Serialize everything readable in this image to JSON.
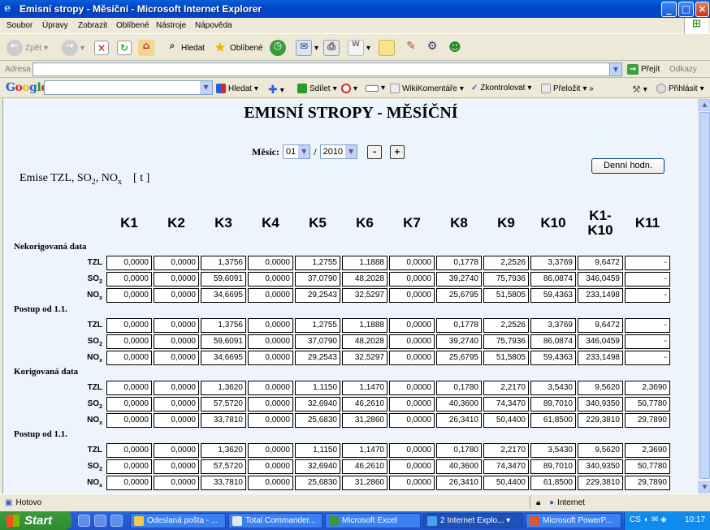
{
  "window": {
    "title": "Emisní stropy - Měsíční - Microsoft Internet Explorer"
  },
  "menu": [
    "Soubor",
    "Úpravy",
    "Zobrazit",
    "Oblíbené",
    "Nástroje",
    "Nápověda"
  ],
  "toolbar": {
    "back": "Zpět",
    "search": "Hledat",
    "favorites": "Oblíbené"
  },
  "address": {
    "label": "Adresa",
    "value": "",
    "go": "Přejít",
    "links": "Odkazy"
  },
  "google": {
    "logo": "Google",
    "search_value": "",
    "search": "Hledat",
    "share": "Sdílet",
    "wiki": "WikiKomentáře",
    "check": "Zkontrolovat",
    "translate": "Přeložit",
    "login": "Přihlásit"
  },
  "page": {
    "title": "EMISNÍ STROPY - MĚSÍČNÍ",
    "month_label": "Měsíc:",
    "month_value": "01",
    "separator": "/",
    "year_value": "2010",
    "minus": "-",
    "plus": "+",
    "daily_button": "Denní hodn.",
    "emise_text": "Emise TZL, SO",
    "emise_sub1": "2",
    "emise_mid": ", NO",
    "emise_sub2": "x",
    "unit": "[ t ]",
    "columns": [
      "K1",
      "K2",
      "K3",
      "K4",
      "K5",
      "K6",
      "K7",
      "K8",
      "K9",
      "K10",
      "K1-\nK10",
      "K11"
    ],
    "groups": [
      {
        "label": "Nekorigovaná data",
        "rows": [
          {
            "name": "TZL",
            "sub": "",
            "values": [
              "0,0000",
              "0,0000",
              "1,3756",
              "0,0000",
              "1,2755",
              "1,1888",
              "0,0000",
              "0,1778",
              "2,2526",
              "3,3769",
              "9,6472",
              "-"
            ]
          },
          {
            "name": "SO",
            "sub": "2",
            "values": [
              "0,0000",
              "0,0000",
              "59,6091",
              "0,0000",
              "37,0790",
              "48,2028",
              "0,0000",
              "39,2740",
              "75,7936",
              "86,0874",
              "346,0459",
              "-"
            ]
          },
          {
            "name": "NO",
            "sub": "x",
            "values": [
              "0,0000",
              "0,0000",
              "34,6695",
              "0,0000",
              "29,2543",
              "32,5297",
              "0,0000",
              "25,6795",
              "51,5805",
              "59,4363",
              "233,1498",
              "-"
            ]
          }
        ]
      },
      {
        "label": "Postup od 1.1.",
        "rows": [
          {
            "name": "TZL",
            "sub": "",
            "values": [
              "0,0000",
              "0,0000",
              "1,3756",
              "0,0000",
              "1,2755",
              "1,1888",
              "0,0000",
              "0,1778",
              "2,2526",
              "3,3769",
              "9,6472",
              "-"
            ]
          },
          {
            "name": "SO",
            "sub": "2",
            "values": [
              "0,0000",
              "0,0000",
              "59,6091",
              "0,0000",
              "37,0790",
              "48,2028",
              "0,0000",
              "39,2740",
              "75,7936",
              "86,0874",
              "346,0459",
              "-"
            ]
          },
          {
            "name": "NO",
            "sub": "x",
            "values": [
              "0,0000",
              "0,0000",
              "34,6695",
              "0,0000",
              "29,2543",
              "32,5297",
              "0,0000",
              "25,6795",
              "51,5805",
              "59,4363",
              "233,1498",
              "-"
            ]
          }
        ]
      },
      {
        "label": "Korigovaná data",
        "rows": [
          {
            "name": "TZL",
            "sub": "",
            "values": [
              "0,0000",
              "0,0000",
              "1,3620",
              "0,0000",
              "1,1150",
              "1,1470",
              "0,0000",
              "0,1780",
              "2,2170",
              "3,5430",
              "9,5620",
              "2,3690"
            ]
          },
          {
            "name": "SO",
            "sub": "2",
            "values": [
              "0,0000",
              "0,0000",
              "57,5720",
              "0,0000",
              "32,6940",
              "46,2610",
              "0,0000",
              "40,3600",
              "74,3470",
              "89,7010",
              "340,9350",
              "50,7780"
            ]
          },
          {
            "name": "NO",
            "sub": "x",
            "values": [
              "0,0000",
              "0,0000",
              "33,7810",
              "0,0000",
              "25,6830",
              "31,2860",
              "0,0000",
              "26,3410",
              "50,4400",
              "61,8500",
              "229,3810",
              "29,7890"
            ]
          }
        ]
      },
      {
        "label": "Postup od 1.1.",
        "rows": [
          {
            "name": "TZL",
            "sub": "",
            "values": [
              "0,0000",
              "0,0000",
              "1,3620",
              "0,0000",
              "1,1150",
              "1,1470",
              "0,0000",
              "0,1780",
              "2,2170",
              "3,5430",
              "9,5620",
              "2,3690"
            ]
          },
          {
            "name": "SO",
            "sub": "2",
            "values": [
              "0,0000",
              "0,0000",
              "57,5720",
              "0,0000",
              "32,6940",
              "46,2610",
              "0,0000",
              "40,3600",
              "74,3470",
              "89,7010",
              "340,9350",
              "50,7780"
            ]
          },
          {
            "name": "NO",
            "sub": "x",
            "values": [
              "0,0000",
              "0,0000",
              "33,7810",
              "0,0000",
              "25,6830",
              "31,2860",
              "0,0000",
              "26,3410",
              "50,4400",
              "61,8500",
              "229,3810",
              "29,7890"
            ]
          }
        ]
      }
    ]
  },
  "status": {
    "text": "Hotovo",
    "zone": "Internet"
  },
  "taskbar": {
    "start": "Start",
    "tasks": [
      "Odeslaná pošta - ...",
      "Total Commander...",
      "Microsoft Excel",
      "2 Internet Explo...",
      "Microsoft PowerP..."
    ],
    "lang": "CS",
    "clock": "10:17"
  }
}
